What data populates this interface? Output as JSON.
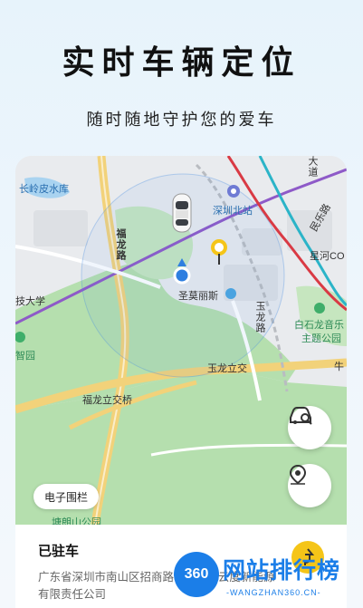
{
  "hero": {
    "title": "实时车辆定位",
    "subtitle": "随时随地守护您的爱车"
  },
  "map": {
    "labels": {
      "changling": "长岭皮水库",
      "shenzhen_north": "深圳北站",
      "fulong_road": "福龙路",
      "min_road": "民乐路",
      "da_dao": "大道",
      "xinghe": "星河CO",
      "university": "技大学",
      "zhiyuan": "智园",
      "shengmo": "圣莫丽斯",
      "yulong_road": "玉龙路",
      "baishilong": "白石龙音乐",
      "theme_park": "主题公园",
      "yulong_interchange": "玉龙立交",
      "fulong_interchange": "福龙立交桥",
      "bottom_partial": "塘朗山公园",
      "right_edge": "牛"
    }
  },
  "buttons": {
    "fence": "电子围栏"
  },
  "icons": {
    "car_search": "car-search-icon",
    "location_pin": "location-pin-icon",
    "navigate": "navigate-arrow-icon",
    "current_location": "current-location-dot",
    "parked_car": "car-top-view-icon",
    "destination_pin": "yellow-pin-icon"
  },
  "vehicle": {
    "status": "已驻车",
    "address": "广东省深圳市南山区招商路...大厦...云度新能源有限责任公司"
  },
  "watermark": {
    "logo": "360",
    "text": "网站排行榜",
    "url": "-WANGZHAN360.CN-"
  },
  "colors": {
    "accent": "#1b7ee8",
    "park_green": "#a9d9a6",
    "road_yellow": "#f2d27a",
    "nav_yellow": "#f5c518"
  }
}
